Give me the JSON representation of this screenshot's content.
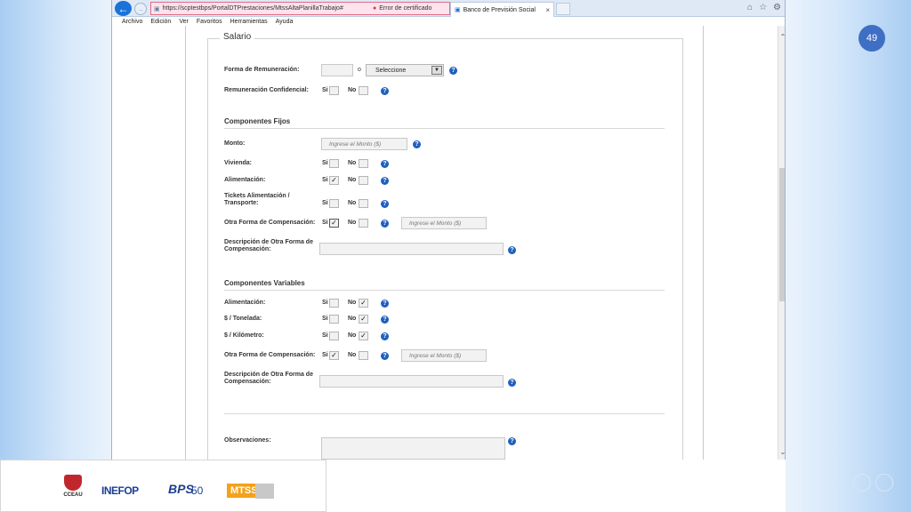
{
  "slide": {
    "number": "49",
    "prev_icon": "‹",
    "next_icon": "›"
  },
  "browser": {
    "url": "https://scptestbps/PortalDTPrestaciones/MtssAltaPlanillaTrabajo#",
    "cert_error": "Error de certificado",
    "tab_title": "Banco de Previsión Social",
    "menu": [
      "Archivo",
      "Edición",
      "Ver",
      "Favoritos",
      "Herramientas",
      "Ayuda"
    ]
  },
  "form": {
    "legend": "Salario",
    "yes": "Si",
    "no": "No",
    "forma_remuneracion": {
      "label": "Forma de Remuneración:",
      "separator": "o",
      "select_value": "Seleccione"
    },
    "remuneracion_confidencial": {
      "label": "Remuneración Confidencial:"
    },
    "fijos": {
      "title": "Componentes Fijos",
      "monto": {
        "label": "Monto:",
        "placeholder": "Ingrese el Monto ($)"
      },
      "vivienda": {
        "label": "Vivienda:"
      },
      "alimentacion": {
        "label": "Alimentación:"
      },
      "tickets": {
        "label_line1": "Tickets Alimentación /",
        "label_line2": "Transporte:"
      },
      "otra": {
        "label": "Otra Forma de Compensación:",
        "placeholder": "Ingrese el Monto ($)"
      },
      "descripcion": {
        "label_line1": "Descripción de Otra Forma de",
        "label_line2": "Compensación:"
      }
    },
    "variables": {
      "title": "Componentes Variables",
      "alimentacion": {
        "label": "Alimentación:"
      },
      "tonelada": {
        "label": "$ / Tonelada:"
      },
      "kilometro": {
        "label": "$ / Kilómetro:"
      },
      "otra": {
        "label": "Otra Forma de Compensación:",
        "placeholder": "Ingrese el Monto ($)"
      },
      "descripcion": {
        "label_line1": "Descripción de Otra Forma de",
        "label_line2": "Compensación:"
      }
    },
    "observaciones": {
      "label": "Observaciones:"
    },
    "check_mark": "✓",
    "help_mark": "?"
  },
  "logos": {
    "cceau": "CCEAU",
    "inefop": "INEFOP",
    "bps": "BPS",
    "bps_50": "50",
    "mtss": "MTSS"
  }
}
